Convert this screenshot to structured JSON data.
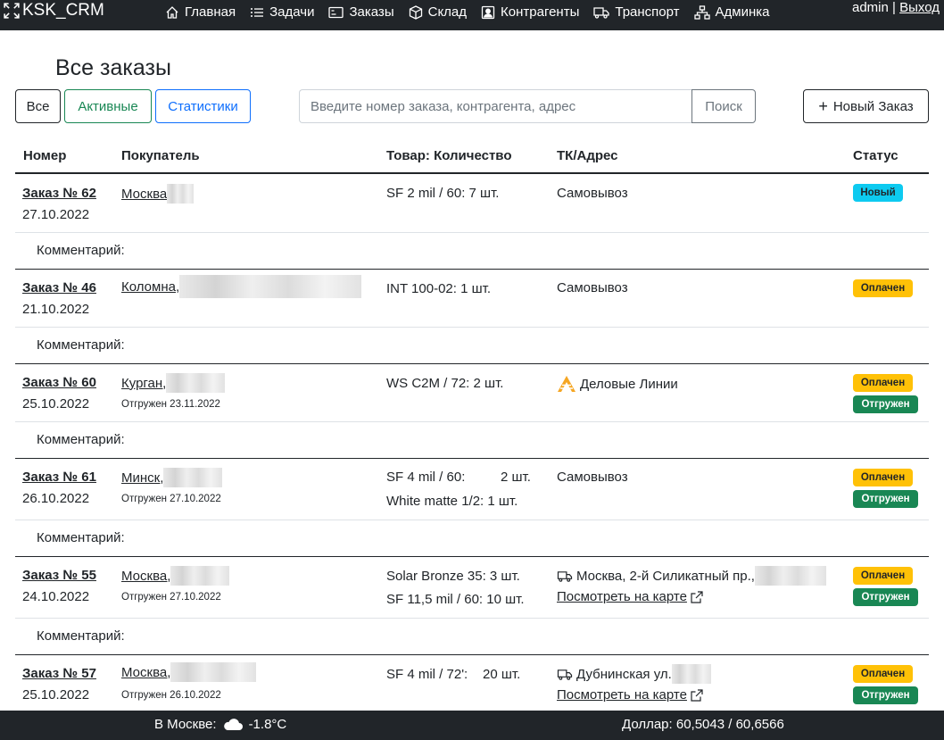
{
  "navbar": {
    "brand": "KSK_CRM",
    "items": [
      {
        "label": "Главная",
        "icon": "house-icon"
      },
      {
        "label": "Задачи",
        "icon": "list-icon"
      },
      {
        "label": "Заказы",
        "icon": "card-icon"
      },
      {
        "label": "Склад",
        "icon": "box-icon"
      },
      {
        "label": "Контрагенты",
        "icon": "person-badge-icon"
      },
      {
        "label": "Транспорт",
        "icon": "truck-icon"
      },
      {
        "label": "Админка",
        "icon": "diagram-icon"
      }
    ],
    "user": "admin",
    "separator": "|",
    "logout": "Выход"
  },
  "page": {
    "title": "Все заказы"
  },
  "toolbar": {
    "all": "Все",
    "active": "Активные",
    "stats": "Статистики",
    "search_placeholder": "Введите номер заказа, контрагента, адрес",
    "search_button": "Поиск",
    "new_order": "Новый Заказ"
  },
  "table": {
    "headers": {
      "number": "Номер",
      "buyer": "Покупатель",
      "goods": "Товар: Количество",
      "tk": "ТК/Адрес",
      "status": "Статус"
    },
    "comment_label": "Комментарий:",
    "orders": [
      {
        "number": "Заказ № 62",
        "date": "27.10.2022",
        "buyer": "Москва",
        "shipped": "",
        "goods": [
          {
            "name": "SF 2 mil / 60:",
            "qty": "7 шт."
          }
        ],
        "tk": "Самовывоз",
        "map": "",
        "status": [
          "Новый"
        ]
      },
      {
        "number": "Заказ № 46",
        "date": "21.10.2022",
        "buyer": "Коломна,",
        "shipped": "",
        "goods": [
          {
            "name": "INT 100-02:",
            "qty": "1 шт."
          }
        ],
        "tk": "Самовывоз",
        "map": "",
        "status": [
          "Оплачен"
        ]
      },
      {
        "number": "Заказ № 60",
        "date": "25.10.2022",
        "buyer": "Курган,",
        "shipped": "Отгружен 23.11.2022",
        "goods": [
          {
            "name": "WS C2M / 72:",
            "qty": "2 шт."
          }
        ],
        "tk": "Деловые Линии",
        "map": "",
        "status": [
          "Оплачен",
          "Отгружен"
        ]
      },
      {
        "number": "Заказ № 61",
        "date": "26.10.2022",
        "buyer": "Минск,",
        "shipped": "Отгружен 27.10.2022",
        "goods": [
          {
            "name": "SF 4 mil / 60:",
            "qty": "2 шт."
          },
          {
            "name": "White matte 1/2:",
            "qty": "1 шт."
          }
        ],
        "tk": "Самовывоз",
        "map": "",
        "status": [
          "Оплачен",
          "Отгружен"
        ]
      },
      {
        "number": "Заказ № 55",
        "date": "24.10.2022",
        "buyer": "Москва,",
        "shipped": "Отгружен 27.10.2022",
        "goods": [
          {
            "name": "Solar Bronze 35:",
            "qty": "3 шт."
          },
          {
            "name": "SF 11,5 mil / 60:",
            "qty": "10 шт."
          }
        ],
        "tk": "Москва, 2-й Силикатный пр.,",
        "map": "Посмотреть на карте",
        "status": [
          "Оплачен",
          "Отгружен"
        ]
      },
      {
        "number": "Заказ № 57",
        "date": "25.10.2022",
        "buyer": "Москва,",
        "shipped": "Отгружен 26.10.2022",
        "goods": [
          {
            "name": "SF 4 mil / 72':",
            "qty": "20 шт."
          }
        ],
        "tk": "Дубнинская ул.",
        "map": "Посмотреть на карте",
        "status": [
          "Оплачен",
          "Отгружен"
        ]
      }
    ]
  },
  "footer": {
    "weather_label": "В Москве:",
    "temperature": "-1.8°C",
    "currency": "Доллар: 60,5043 / 60,6566"
  },
  "colors": {
    "dark": "#212529",
    "success": "#198754",
    "primary": "#0d6efd",
    "info": "#0dcaf0",
    "warning": "#ffc107"
  }
}
